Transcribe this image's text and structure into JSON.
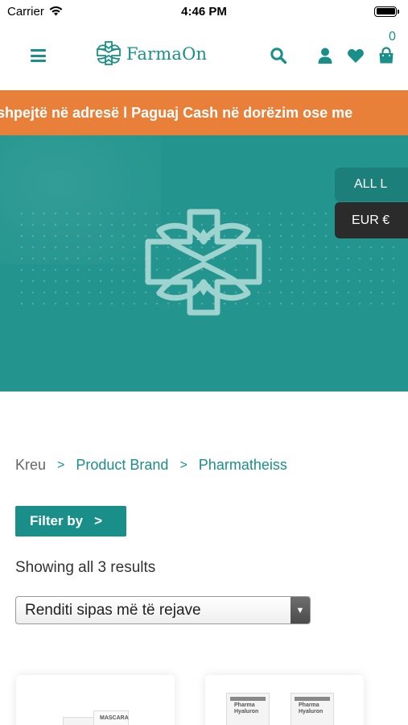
{
  "status_bar": {
    "carrier": "Carrier",
    "time": "4:46 PM"
  },
  "header": {
    "logo_text": "FarmaOn",
    "cart_count": "0"
  },
  "announcement": {
    "text": "shpejtë në adresë l Paguaj Cash në dorëzim ose me"
  },
  "hero": {
    "language_label": "ALL L",
    "currency_label": "EUR €"
  },
  "breadcrumb": {
    "home": "Kreu",
    "separator": ">",
    "level1": "Product Brand",
    "level2": "Pharmatheiss"
  },
  "filter": {
    "label": "Filter by",
    "chevron": ">"
  },
  "results": {
    "text": "Showing all 3 results"
  },
  "sort": {
    "selected": "Renditi sipas më të rejave"
  },
  "products": [
    {
      "box_label": "MASCARA"
    },
    {
      "box_label_1": "Pharma Hyaluron",
      "box_label_2": "Pharma Hyaluron"
    }
  ],
  "colors": {
    "brand": "#1a8f8a",
    "banner": "#e8803a",
    "hero": "#23958e",
    "currency_bg": "#2b2b2b"
  }
}
